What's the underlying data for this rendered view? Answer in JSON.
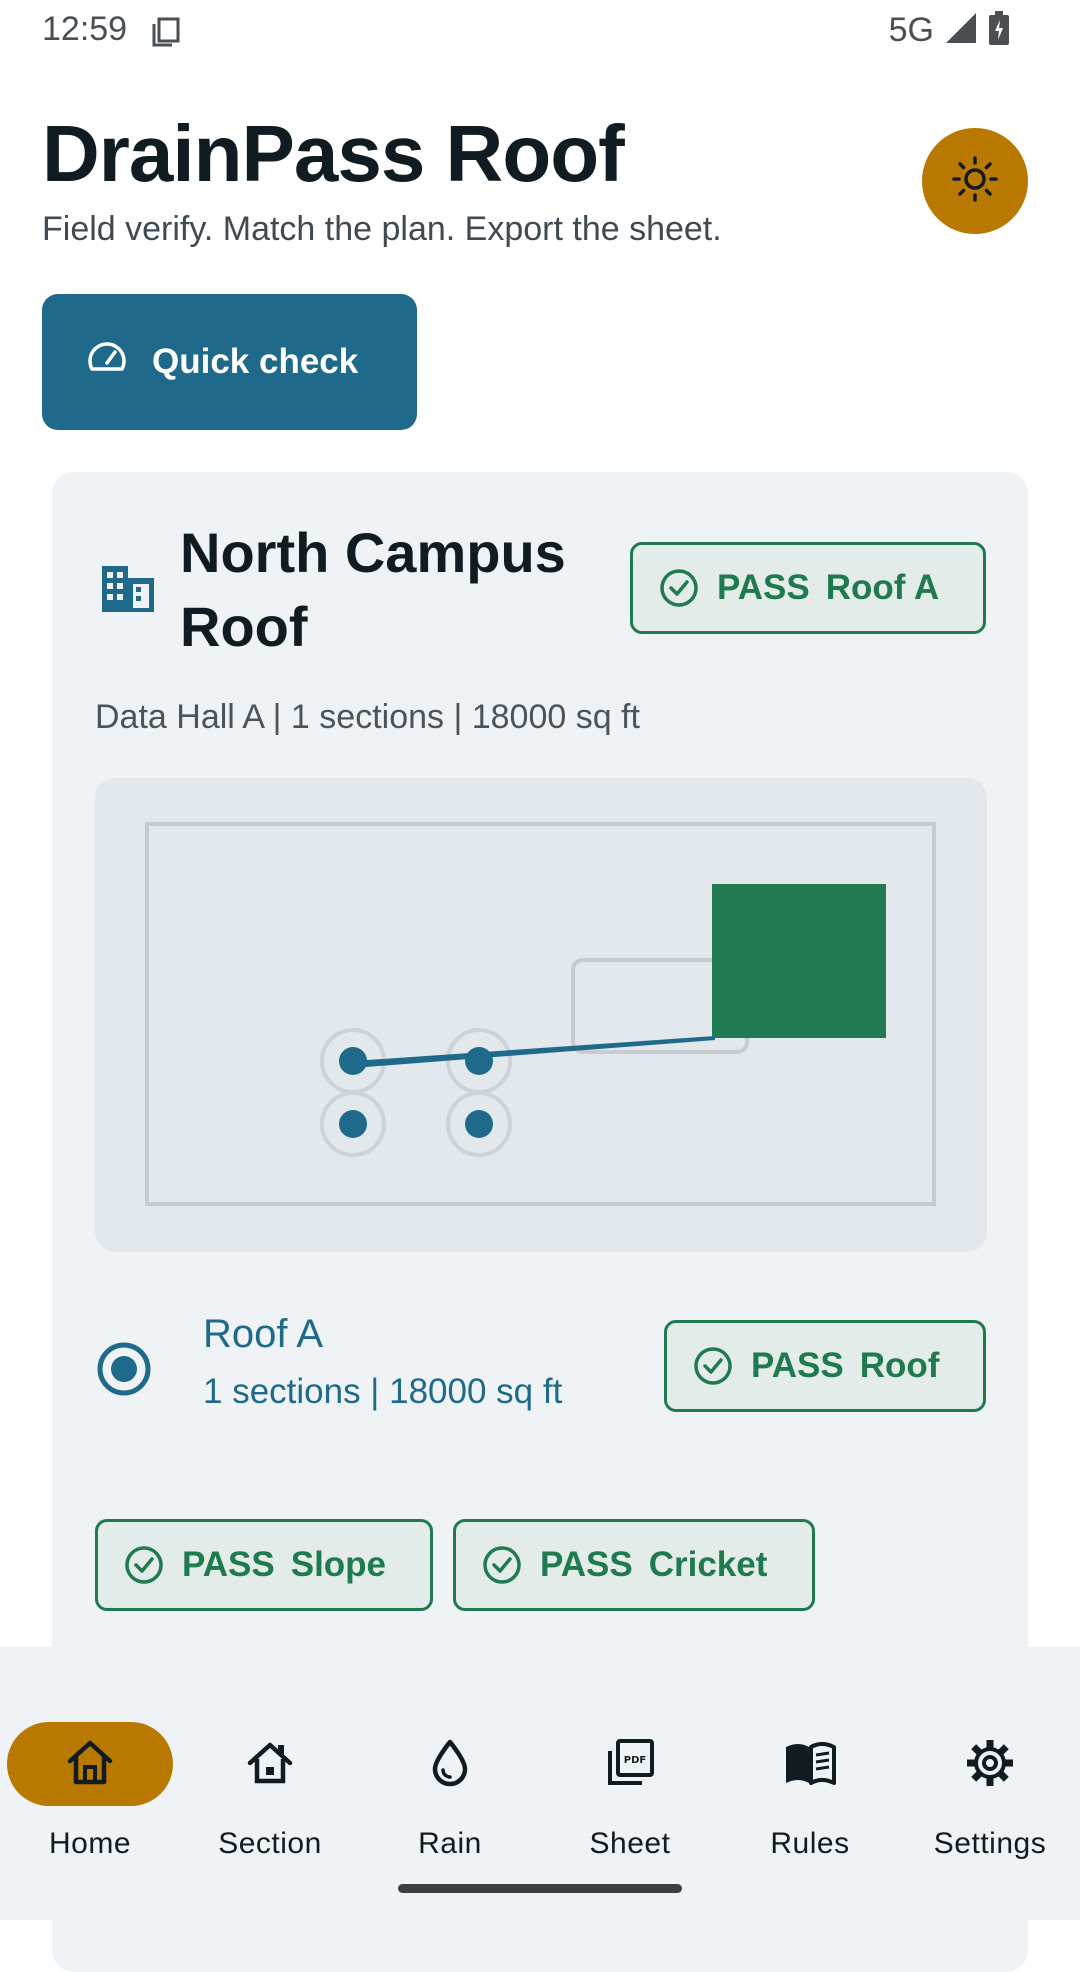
{
  "status_bar": {
    "time": "12:59",
    "network": "5G"
  },
  "header": {
    "title": "DrainPass Roof",
    "subtitle": "Field verify. Match the plan. Export the sheet."
  },
  "quick_check": {
    "label": "Quick check"
  },
  "project": {
    "title": "North Campus Roof",
    "badge": {
      "status": "PASS",
      "label": "Roof A"
    },
    "meta": "Data Hall A | 1 sections | 18000 sq ft"
  },
  "section": {
    "name": "Roof A",
    "meta": "1 sections | 18000 sq ft",
    "badge": {
      "status": "PASS",
      "label": "Roof"
    }
  },
  "checks": [
    {
      "status": "PASS",
      "label": "Slope"
    },
    {
      "status": "PASS",
      "label": "Cricket"
    }
  ],
  "nav": {
    "items": [
      {
        "label": "Home",
        "icon": "home-icon",
        "active": true
      },
      {
        "label": "Section",
        "icon": "section-icon"
      },
      {
        "label": "Rain",
        "icon": "rain-drop-icon"
      },
      {
        "label": "Sheet",
        "icon": "pdf-icon"
      },
      {
        "label": "Rules",
        "icon": "book-icon"
      },
      {
        "label": "Settings",
        "icon": "gear-icon"
      }
    ]
  },
  "colors": {
    "primary": "#1f6a8a",
    "accent": "#b97800",
    "pass": "#1f7a4f",
    "card_bg": "#eff3f6"
  }
}
